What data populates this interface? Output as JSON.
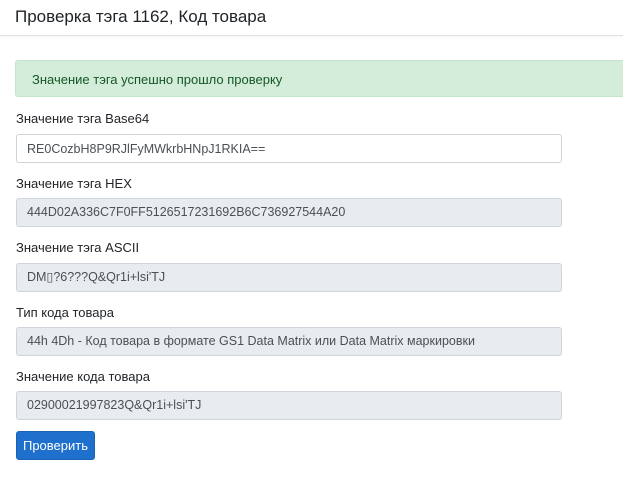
{
  "header": {
    "title": "Проверка тэга 1162, Код товара"
  },
  "alert": {
    "message": "Значение тэга успешно прошло проверку",
    "color": "#d4edda"
  },
  "form": {
    "base64": {
      "label": "Значение тэга Base64",
      "value": "RE0CozbH8P9RJlFyMWkrbHNpJ1RKIA=="
    },
    "hex": {
      "label": "Значение тэга HEX",
      "value": "444D02A336C7F0FF5126517231692B6C736927544A20"
    },
    "ascii": {
      "label": "Значение тэга ASCII",
      "value": "DM▯?6???Q&Qr1i+lsi'TJ"
    },
    "code_type": {
      "label": "Тип кода товара",
      "value": "44h 4Dh - Код товара в формате GS1 Data Matrix или Data Matrix маркировки"
    },
    "code_value": {
      "label": "Значение кода товара",
      "value": "02900021997823Q&Qr1i+lsi'TJ"
    },
    "submit_label": "Проверить",
    "accent_color": "#1f6fcc"
  }
}
